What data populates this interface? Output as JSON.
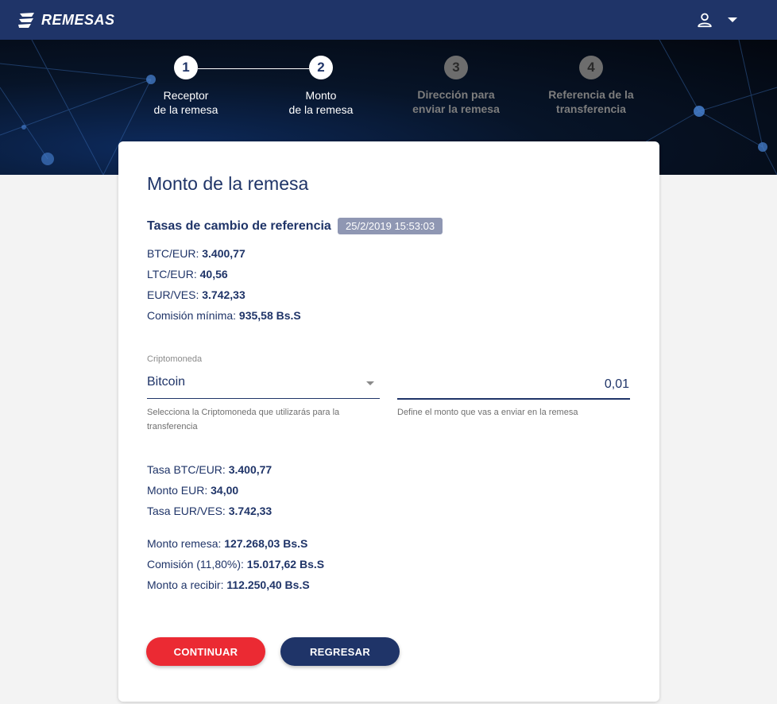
{
  "header": {
    "brand": "REMESAS",
    "icons": {
      "logo": "remesas-logo-icon",
      "user": "user-icon",
      "menu": "chevron-down-icon"
    }
  },
  "steps": [
    {
      "number": "1",
      "line1": "Receptor",
      "line2": "de la remesa",
      "state": "active"
    },
    {
      "number": "2",
      "line1": "Monto",
      "line2": "de la remesa",
      "state": "active"
    },
    {
      "number": "3",
      "line1": "Dirección para",
      "line2": "enviar la remesa",
      "state": "inactive"
    },
    {
      "number": "4",
      "line1": "Referencia de la",
      "line2": "transferencia",
      "state": "inactive"
    }
  ],
  "card": {
    "title": "Monto de la remesa",
    "rates": {
      "heading": "Tasas de cambio de referencia",
      "date": "25/2/2019 15:53:03",
      "items": [
        {
          "label": "BTC/EUR: ",
          "value": "3.400,77"
        },
        {
          "label": "LTC/EUR: ",
          "value": "40,56"
        },
        {
          "label": "EUR/VES: ",
          "value": "3.742,33"
        },
        {
          "label": "Comisión mínima: ",
          "value": "935,58 Bs.S"
        }
      ]
    },
    "crypto": {
      "label": "Criptomoneda",
      "value": "Bitcoin",
      "help_line1": "Selecciona la Criptomoneda que utilizarás para la",
      "help_line2": "transferencia"
    },
    "amount": {
      "value": "0,01",
      "help": "Define el monto que vas a enviar en la remesa"
    },
    "conversion": [
      {
        "label": "Tasa BTC/EUR: ",
        "value": "3.400,77"
      },
      {
        "label": "Monto EUR: ",
        "value": "34,00"
      },
      {
        "label": "Tasa EUR/VES: ",
        "value": "3.742,33"
      }
    ],
    "summary": [
      {
        "label": "Monto remesa: ",
        "value": "127.268,03 Bs.S"
      },
      {
        "label": "Comisión (11,80%): ",
        "value": "15.017,62 Bs.S"
      },
      {
        "label": "Monto a recibir: ",
        "value": "112.250,40 Bs.S"
      }
    ],
    "buttons": {
      "continue": "CONTINUAR",
      "back": "REGRESAR"
    }
  },
  "colors": {
    "primary": "#1f3468",
    "accent": "#eb2a33",
    "badge": "#8f97b3"
  }
}
